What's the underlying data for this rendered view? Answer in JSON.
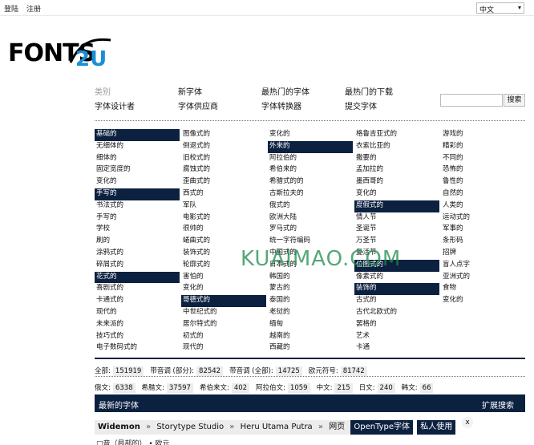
{
  "topbar": {
    "login": "登陆",
    "register": "注册",
    "language": "中文"
  },
  "nav": [
    [
      "类别",
      "新字体",
      "最热门的字体",
      "最热门的下载"
    ],
    [
      "字体设计者",
      "字体供应商",
      "字体转换器",
      "提交字体"
    ]
  ],
  "search": {
    "button": "搜索"
  },
  "categories": [
    [
      {
        "t": "基础的",
        "h": true
      },
      {
        "t": "无细体的"
      },
      {
        "t": "细体的"
      },
      {
        "t": "固定宽度的"
      },
      {
        "t": "变化的"
      },
      {
        "t": "手写的",
        "h": true
      },
      {
        "t": "书法式的"
      },
      {
        "t": "手写的"
      },
      {
        "t": "学校"
      },
      {
        "t": "刷的"
      },
      {
        "t": "涂鸦式的"
      },
      {
        "t": "碎屑式的"
      },
      {
        "t": "花式的",
        "h": true
      },
      {
        "t": "喜剧式的"
      },
      {
        "t": "卡通式的"
      },
      {
        "t": "现代的"
      },
      {
        "t": "未来派的"
      },
      {
        "t": "技巧式的"
      },
      {
        "t": "电子数码式的"
      }
    ],
    [
      {
        "t": "图像式的"
      },
      {
        "t": "倒退式的"
      },
      {
        "t": "旧校式的"
      },
      {
        "t": "腐蚀式的"
      },
      {
        "t": "歪曲式的"
      },
      {
        "t": "西式的"
      },
      {
        "t": "军队"
      },
      {
        "t": "电影式的"
      },
      {
        "t": "很帅的"
      },
      {
        "t": "蜷曲式的"
      },
      {
        "t": "装饰式的"
      },
      {
        "t": "轮廓式的"
      },
      {
        "t": "害怕的"
      },
      {
        "t": "变化的"
      },
      {
        "t": "哥德式的",
        "h": true
      },
      {
        "t": "中世纪式的"
      },
      {
        "t": "居尔特式的"
      },
      {
        "t": "初式的"
      },
      {
        "t": "现代的"
      }
    ],
    [
      {
        "t": "变化的"
      },
      {
        "t": "外来的",
        "h": true
      },
      {
        "t": "阿拉伯的"
      },
      {
        "t": "希伯来的"
      },
      {
        "t": "希腊式的的"
      },
      {
        "t": "古斯拉夫的"
      },
      {
        "t": "俄式的"
      },
      {
        "t": "欧洲大陆"
      },
      {
        "t": "罗马式的"
      },
      {
        "t": "统一字符编码"
      },
      {
        "t": "中国式的"
      },
      {
        "t": "日本式的"
      },
      {
        "t": "韩国的"
      },
      {
        "t": "蒙古的"
      },
      {
        "t": "泰国的"
      },
      {
        "t": "老挝的"
      },
      {
        "t": "缅甸"
      },
      {
        "t": "越南的"
      },
      {
        "t": "西藏的"
      }
    ],
    [
      {
        "t": "格鲁吉亚式的"
      },
      {
        "t": "衣索比亚的"
      },
      {
        "t": "撒要的"
      },
      {
        "t": "孟加拉的"
      },
      {
        "t": "墨西哥的"
      },
      {
        "t": "变化的"
      },
      {
        "t": "度假式的",
        "h": true
      },
      {
        "t": "情人节"
      },
      {
        "t": "圣诞节"
      },
      {
        "t": "万圣节"
      },
      {
        "t": "复活节"
      },
      {
        "t": "位图式的",
        "h": true
      },
      {
        "t": "像素式的"
      },
      {
        "t": "装饰的",
        "h": true
      },
      {
        "t": "古式的"
      },
      {
        "t": "古代北欧式的"
      },
      {
        "t": "罢格的"
      },
      {
        "t": "艺术"
      },
      {
        "t": "卡通"
      }
    ],
    [
      {
        "t": "游戏的"
      },
      {
        "t": "精彩的"
      },
      {
        "t": "不同的"
      },
      {
        "t": "恐怖的"
      },
      {
        "t": "鲁性的"
      },
      {
        "t": "自然的"
      },
      {
        "t": "人类的"
      },
      {
        "t": "运动式的"
      },
      {
        "t": "军事的"
      },
      {
        "t": "条形码"
      },
      {
        "t": "招牌"
      },
      {
        "t": "盲人点字"
      },
      {
        "t": "亚洲式的"
      },
      {
        "t": "食物"
      },
      {
        "t": "变化的"
      }
    ]
  ],
  "stats1": [
    {
      "k": "全部:",
      "v": "151919"
    },
    {
      "k": "带音调 (部分):",
      "v": "82542"
    },
    {
      "k": "带音调 (全部):",
      "v": "14725"
    },
    {
      "k": "欧元符号:",
      "v": "81742"
    }
  ],
  "stats2": [
    {
      "k": "俄文:",
      "v": "6338"
    },
    {
      "k": "希腊文:",
      "v": "37597"
    },
    {
      "k": "希伯来文:",
      "v": "402"
    },
    {
      "k": "阿拉伯文:",
      "v": "1059"
    },
    {
      "k": "中文:",
      "v": "215"
    },
    {
      "k": "日文:",
      "v": "240"
    },
    {
      "k": "韩文:",
      "v": "66"
    }
  ],
  "latest": {
    "title": "最新的字体",
    "advanced": "扩展搜索"
  },
  "crumb": {
    "font": "Widemon",
    "studio": "Storytype Studio",
    "author": "Heru Utama Putra",
    "web": "网页",
    "badge1": "OpenType字体",
    "badge2": "私人使用",
    "sep": "»"
  },
  "close": "x",
  "bottom": "□音（局部的） • 欧元",
  "watermark": "KUAIMAO.COM",
  "colors": {
    "navy": "#0c2140",
    "logo_blue": "#1a8fd6",
    "logo_black": "#000000"
  }
}
